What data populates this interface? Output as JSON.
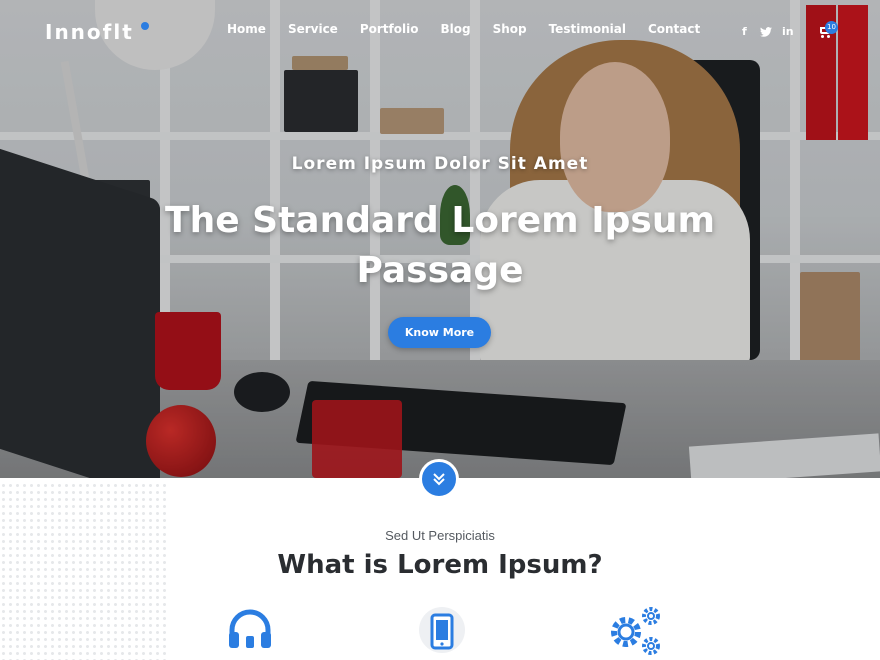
{
  "brand": {
    "logo": "Innoflt",
    "accent": "#2b7de1"
  },
  "nav": {
    "items": [
      {
        "label": "Home"
      },
      {
        "label": "Service"
      },
      {
        "label": "Portfolio"
      },
      {
        "label": "Blog"
      },
      {
        "label": "Shop"
      },
      {
        "label": "Testimonial"
      },
      {
        "label": "Contact"
      }
    ],
    "social": {
      "facebook": "f",
      "twitter": "twitter-icon",
      "linkedin": "in"
    },
    "cart": {
      "icon": "cart-icon",
      "count": "10"
    }
  },
  "hero": {
    "subtitle": "Lorem Ipsum Dolor Sit Amet",
    "title": "The Standard Lorem Ipsum Passage",
    "button": "Know More",
    "scroll_icon": "double-chevron-down-icon"
  },
  "section": {
    "subtitle": "Sed Ut Perspiciatis",
    "title": "What is Lorem Ipsum?",
    "icons": [
      "headphones-icon",
      "smartphone-icon",
      "gears-icon"
    ]
  }
}
